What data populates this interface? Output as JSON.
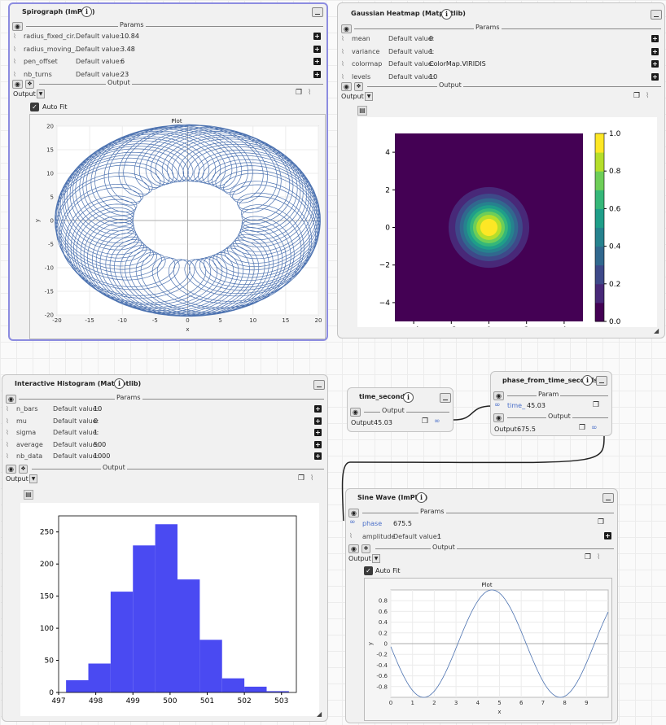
{
  "spirograph": {
    "title": "Spirograph (ImPlot)",
    "params_label": "Params",
    "output_label": "Output",
    "output_select": "Output",
    "auto_fit": "Auto Fit",
    "params": [
      {
        "name": "radius_fixed_cir...",
        "dv": "Default value:",
        "value": "10.84"
      },
      {
        "name": "radius_moving_...",
        "dv": "Default value:",
        "value": "3.48"
      },
      {
        "name": "pen_offset",
        "dv": "Default value:",
        "value": "6"
      },
      {
        "name": "nb_turns",
        "dv": "Default value:",
        "value": "23"
      }
    ],
    "chart_data": {
      "type": "line",
      "title": "Plot",
      "xlabel": "x",
      "ylabel": "y",
      "xlim": [
        -20,
        20
      ],
      "ylim": [
        -20,
        20
      ],
      "xticks": [
        "-20",
        "-15",
        "-10",
        "-5",
        "0",
        "5",
        "10",
        "15",
        "20"
      ],
      "yticks": [
        "20",
        "15",
        "10",
        "5",
        "0",
        "-5",
        "-10",
        "-15",
        "-20"
      ],
      "params": {
        "R": 10.84,
        "r": 3.48,
        "d": 6,
        "turns": 23
      },
      "color": "#4c72b0"
    }
  },
  "heatmap": {
    "title": "Gaussian Heatmap (Matplotlib)",
    "params_label": "Params",
    "output_label": "Output",
    "output_select": "Output",
    "params": [
      {
        "name": "mean",
        "dv": "Default value:",
        "value": "0"
      },
      {
        "name": "variance",
        "dv": "Default value:",
        "value": "1"
      },
      {
        "name": "colormap",
        "dv": "Default value:",
        "value": "ColorMap.VIRIDIS"
      },
      {
        "name": "levels",
        "dv": "Default value:",
        "value": "10"
      }
    ],
    "chart_data": {
      "type": "heatmap",
      "xlim": [
        -5,
        5
      ],
      "ylim": [
        -5,
        5
      ],
      "xticks": [
        "−4",
        "−2",
        "0",
        "2",
        "4"
      ],
      "yticks": [
        "4",
        "2",
        "0",
        "−2",
        "−4"
      ],
      "colorbar_ticks": [
        "1.0",
        "0.8",
        "0.6",
        "0.4",
        "0.2",
        "0.0"
      ],
      "mean": 0,
      "variance": 1,
      "levels": 10,
      "colormap": [
        "#440154",
        "#482878",
        "#3e4989",
        "#31688e",
        "#26828e",
        "#1f9e89",
        "#35b779",
        "#6ece58",
        "#b5de2b",
        "#fde725"
      ]
    }
  },
  "histogram": {
    "title": "Interactive Histogram (Matplotlib)",
    "params_label": "Params",
    "output_label": "Output",
    "output_select": "Output",
    "params": [
      {
        "name": "n_bars",
        "dv": "Default value:",
        "value": "10"
      },
      {
        "name": "mu",
        "dv": "Default value:",
        "value": "0"
      },
      {
        "name": "sigma",
        "dv": "Default value:",
        "value": "1"
      },
      {
        "name": "average",
        "dv": "Default value:",
        "value": "500"
      },
      {
        "name": "nb_data",
        "dv": "Default value:",
        "value": "1000"
      }
    ],
    "chart_data": {
      "type": "bar",
      "bins": [
        [
          497.2,
          497.8
        ],
        [
          497.8,
          498.4
        ],
        [
          498.4,
          499.0
        ],
        [
          499.0,
          499.6
        ],
        [
          499.6,
          500.2
        ],
        [
          500.2,
          500.8
        ],
        [
          500.8,
          501.4
        ],
        [
          501.4,
          502.0
        ],
        [
          502.0,
          502.6
        ],
        [
          502.6,
          503.2
        ]
      ],
      "values": [
        19,
        45,
        157,
        229,
        262,
        176,
        82,
        22,
        9,
        2
      ],
      "xlim": [
        497,
        503.4
      ],
      "ylim": [
        0,
        275
      ],
      "xticks": [
        "497",
        "498",
        "499",
        "500",
        "501",
        "502",
        "503"
      ],
      "yticks": [
        "250",
        "200",
        "150",
        "100",
        "50",
        "0"
      ],
      "color": "#4a4af2"
    }
  },
  "time_seconds": {
    "title": "time_seconds",
    "output_label": "Output",
    "output_text": "Output",
    "output_value": "45.03"
  },
  "phase_from_time": {
    "title": "phase_from_time_seconds",
    "param_label": "Param",
    "param_name": "time_",
    "param_value": "45.03",
    "output_label": "Output",
    "output_text": "Output",
    "output_value": "675.5"
  },
  "sine": {
    "title": "Sine Wave (ImPlot)",
    "params_label": "Params",
    "output_label": "Output",
    "output_select": "Output",
    "auto_fit": "Auto Fit",
    "phase_name": "phase",
    "phase_value": "675.5",
    "amp_name": "amplitude",
    "amp_dv": "Default value:",
    "amp_value": "1",
    "chart_data": {
      "type": "line",
      "title": "Plot",
      "xlabel": "x",
      "ylabel": "y",
      "xlim": [
        0,
        10
      ],
      "ylim": [
        -1,
        1
      ],
      "xticks": [
        "0",
        "1",
        "2",
        "3",
        "4",
        "5",
        "6",
        "7",
        "8",
        "9"
      ],
      "yticks": [
        "0.8",
        "0.6",
        "0.4",
        "0.2",
        "0",
        "-0.2",
        "-0.4",
        "-0.6",
        "-0.8"
      ],
      "phase": 675.5,
      "amplitude": 1,
      "color": "#4c72b0"
    }
  }
}
